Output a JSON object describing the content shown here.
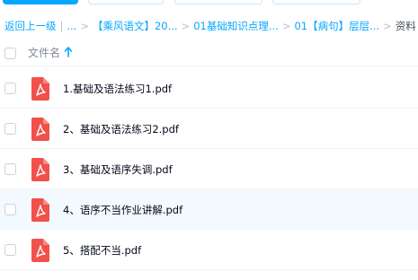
{
  "breadcrumb": {
    "back": "返回上一级",
    "sep1": "|",
    "ellipsis": "...",
    "sep2": ">",
    "crumb1": "【乘风语文】20...",
    "sep3": ">",
    "crumb2": "01基础知识点理...",
    "sep4": ">",
    "crumb3": "01【病句】层层...",
    "sep5": ">",
    "current": "资料"
  },
  "list_header": {
    "column_name": "文件名"
  },
  "files": [
    {
      "name": "1.基础及语法练习1.pdf"
    },
    {
      "name": "2、基础及语法练习2.pdf"
    },
    {
      "name": "3、基础及语序失调.pdf"
    },
    {
      "name": "4、语序不当作业讲解.pdf"
    },
    {
      "name": "5、搭配不当.pdf"
    }
  ],
  "colors": {
    "accent": "#06a7ff",
    "pdf_red": "#f2504b",
    "row_hover": "#f3faff"
  }
}
